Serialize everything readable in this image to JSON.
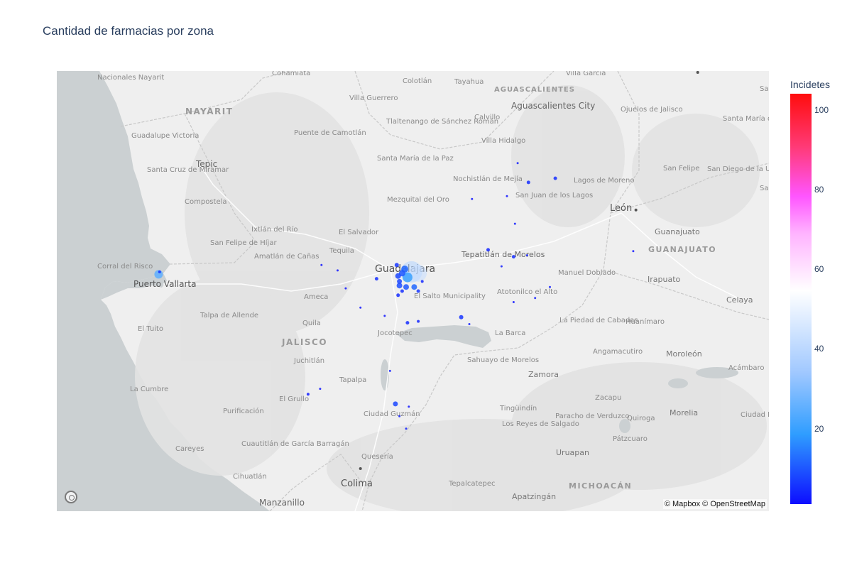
{
  "title": "Cantidad de farmacias por zona",
  "attribution": "© Mapbox © OpenStreetMap",
  "colorbar": {
    "title": "Incidetes",
    "ticks": [
      "20",
      "40",
      "60",
      "80",
      "100"
    ],
    "range": [
      1,
      104
    ]
  },
  "map_labels": {
    "nacionales_nayarit": "Nacionales Nayarit",
    "cohamiata": "Cohamiata",
    "colotlan": "Colotlán",
    "tayahua": "Tayahua",
    "villa_garcia": "Villa García",
    "aguascalientes_state": "AGUASCALIENTES",
    "aguascalientes_city": "Aguascalientes City",
    "ojuelos": "Ojuelos de Jalisco",
    "santa_maria_del_rio": "Santa María del Río",
    "nayarit": "NAYARIT",
    "villa_guerrero": "Villa Guerrero",
    "tlaltenango": "Tlaltenango de Sánchez Román",
    "calvillo": "Calvillo",
    "villa_hidalgo": "Villa Hidalgo",
    "guadalupe_victoria": "Guadalupe Victoria",
    "puente_camotlan": "Puente de Camotlán",
    "tepic": "Tepic",
    "santa_maria_paz": "Santa María de la Paz",
    "nochistlan": "Nochistlán de Mejía",
    "lagos": "Lagos de Moreno",
    "san_felipe": "San Felipe",
    "san_diego_union": "San Diego de la Unión",
    "santa_cruz_miramar": "Santa Cruz de Miramar",
    "mezquital": "Mezquital del Oro",
    "san_juan_lagos": "San Juan de los Lagos",
    "compostela": "Compostela",
    "leon": "León",
    "guanajuato": "Guanajuato",
    "ixtlan": "Ixtlán del Río",
    "el_salvador": "El Salvador",
    "san_felipe_hijar": "San Felipe de Híjar",
    "amatlan": "Amatlán de Cañas",
    "tequila": "Tequila",
    "guadalajara": "Guadalajara",
    "tepatitlan": "Tepatitlán de Morelos",
    "manuel_doblado": "Manuel Doblado",
    "guanajuato_state": "GUANAJUATO",
    "corral_risco": "Corral del Risco",
    "puerto_vallarta": "Puerto Vallarta",
    "irapuato": "Irapuato",
    "ameca": "Ameca",
    "el_salto": "El Salto Municipality",
    "atotonilco": "Atotonilco el Alto",
    "celaya": "Celaya",
    "talpa": "Talpa de Allende",
    "quila": "Quila",
    "la_piedad": "La Piedad de Cabadas",
    "huanimaro": "Huanímaro",
    "el_tuito": "El Tuito",
    "jalisco": "JALISCO",
    "jocotepec": "Jocotepec",
    "la_barca": "La Barca",
    "angamacutiro": "Angamacutiro",
    "moroleon": "Moroleón",
    "acambaro": "Acámbaro",
    "juchitlan": "Juchitlán",
    "sahuayo": "Sahuayo de Morelos",
    "zamora": "Zamora",
    "tapalpa": "Tapalpa",
    "la_cumbre": "La Cumbre",
    "el_grullo": "El Grullo",
    "zacapu": "Zacapu",
    "purificacion": "Purificación",
    "ciudad_guzman": "Ciudad Guzmán",
    "tinguindin": "Tingüindín",
    "paracho": "Paracho de Verduzco",
    "morelia": "Morelia",
    "ciudad_hidalgo": "Ciudad Hi",
    "quiroga": "Quiroga",
    "los_reyes": "Los Reyes de Salgado",
    "cuautitlan": "Cuautitlán de García Barragán",
    "careyes": "Careyes",
    "patzcuaro": "Pátzcuaro",
    "uruapan": "Uruapan",
    "queseria": "Quesería",
    "cihuatlan": "Cihuatlán",
    "colima": "Colima",
    "tepalcatepec": "Tepalcatepec",
    "michoacan": "MICHOACÁN",
    "apatzingan": "Apatzingán",
    "manzanillo": "Manzanillo",
    "santa_edge": "Sant",
    "san_edge": "Sa"
  },
  "points": [
    {
      "lon": -105.232,
      "lat": 20.652,
      "value": 25,
      "size": 12
    },
    {
      "lon": -105.225,
      "lat": 20.67,
      "value": 5,
      "size": 4
    },
    {
      "lon": -103.35,
      "lat": 20.67,
      "value": 38,
      "size": 30
    },
    {
      "lon": -103.3,
      "lat": 20.66,
      "value": 42,
      "size": 24
    },
    {
      "lon": -103.4,
      "lat": 20.69,
      "value": 12,
      "size": 10
    },
    {
      "lon": -103.42,
      "lat": 20.66,
      "value": 10,
      "size": 9
    },
    {
      "lon": -103.38,
      "lat": 20.63,
      "value": 20,
      "size": 14
    },
    {
      "lon": -103.45,
      "lat": 20.64,
      "value": 8,
      "size": 8
    },
    {
      "lon": -103.44,
      "lat": 20.6,
      "value": 8,
      "size": 7
    },
    {
      "lon": -103.44,
      "lat": 20.57,
      "value": 9,
      "size": 8
    },
    {
      "lon": -103.39,
      "lat": 20.56,
      "value": 10,
      "size": 8
    },
    {
      "lon": -103.33,
      "lat": 20.56,
      "value": 12,
      "size": 8
    },
    {
      "lon": -103.3,
      "lat": 20.53,
      "value": 6,
      "size": 5
    },
    {
      "lon": -103.46,
      "lat": 20.72,
      "value": 6,
      "size": 6
    },
    {
      "lon": -103.42,
      "lat": 20.53,
      "value": 5,
      "size": 5
    },
    {
      "lon": -103.45,
      "lat": 20.5,
      "value": 5,
      "size": 5
    },
    {
      "lon": -103.27,
      "lat": 20.6,
      "value": 4,
      "size": 4
    },
    {
      "lon": -103.61,
      "lat": 20.62,
      "value": 5,
      "size": 5
    },
    {
      "lon": -103.84,
      "lat": 20.55,
      "value": 2,
      "size": 3
    },
    {
      "lon": -104.02,
      "lat": 20.72,
      "value": 2,
      "size": 3
    },
    {
      "lon": -103.9,
      "lat": 20.68,
      "value": 2,
      "size": 3
    },
    {
      "lon": -103.73,
      "lat": 20.41,
      "value": 2,
      "size": 3
    },
    {
      "lon": -103.55,
      "lat": 20.35,
      "value": 2,
      "size": 3
    },
    {
      "lon": -103.38,
      "lat": 20.3,
      "value": 5,
      "size": 5
    },
    {
      "lon": -103.3,
      "lat": 20.31,
      "value": 4,
      "size": 4
    },
    {
      "lon": -102.98,
      "lat": 20.34,
      "value": 6,
      "size": 6
    },
    {
      "lon": -102.92,
      "lat": 20.29,
      "value": 3,
      "size": 3
    },
    {
      "lon": -102.78,
      "lat": 20.83,
      "value": 4,
      "size": 5
    },
    {
      "lon": -102.59,
      "lat": 20.78,
      "value": 5,
      "size": 5
    },
    {
      "lon": -102.49,
      "lat": 20.79,
      "value": 3,
      "size": 3
    },
    {
      "lon": -102.68,
      "lat": 20.71,
      "value": 3,
      "size": 3
    },
    {
      "lon": -102.43,
      "lat": 20.48,
      "value": 3,
      "size": 3
    },
    {
      "lon": -102.59,
      "lat": 20.45,
      "value": 2,
      "size": 3
    },
    {
      "lon": -102.48,
      "lat": 21.32,
      "value": 5,
      "size": 5
    },
    {
      "lon": -102.56,
      "lat": 21.46,
      "value": 3,
      "size": 3
    },
    {
      "lon": -102.28,
      "lat": 21.35,
      "value": 5,
      "size": 5
    },
    {
      "lon": -102.58,
      "lat": 21.02,
      "value": 3,
      "size": 3
    },
    {
      "lon": -102.64,
      "lat": 21.22,
      "value": 2,
      "size": 3
    },
    {
      "lon": -102.9,
      "lat": 21.2,
      "value": 2,
      "size": 3
    },
    {
      "lon": -102.32,
      "lat": 20.56,
      "value": 3,
      "size": 3
    },
    {
      "lon": -103.47,
      "lat": 19.71,
      "value": 8,
      "size": 7
    },
    {
      "lon": -103.44,
      "lat": 19.62,
      "value": 3,
      "size": 3
    },
    {
      "lon": -103.39,
      "lat": 19.53,
      "value": 3,
      "size": 3
    },
    {
      "lon": -103.51,
      "lat": 19.95,
      "value": 3,
      "size": 3
    },
    {
      "lon": -104.12,
      "lat": 19.78,
      "value": 3,
      "size": 4
    },
    {
      "lon": -104.03,
      "lat": 19.82,
      "value": 2,
      "size": 3
    },
    {
      "lon": -103.37,
      "lat": 19.69,
      "value": 2,
      "size": 3
    },
    {
      "lon": -101.7,
      "lat": 20.82,
      "value": 2,
      "size": 3
    }
  ],
  "towns": [
    {
      "lon": -101.68,
      "lat": 21.12
    },
    {
      "lon": -103.73,
      "lat": 19.24
    },
    {
      "lon": -101.22,
      "lat": 22.12
    }
  ]
}
